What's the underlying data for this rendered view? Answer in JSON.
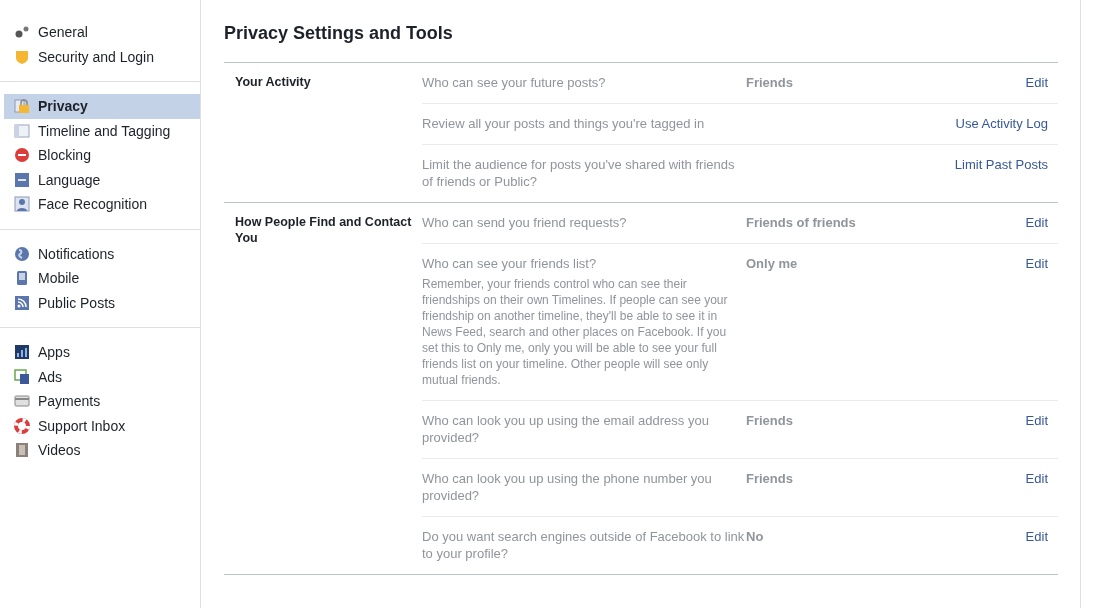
{
  "sidebar": {
    "groups": [
      {
        "items": [
          {
            "label": "General",
            "selected": false
          },
          {
            "label": "Security and Login",
            "selected": false
          }
        ]
      },
      {
        "items": [
          {
            "label": "Privacy",
            "selected": true
          },
          {
            "label": "Timeline and Tagging",
            "selected": false
          },
          {
            "label": "Blocking",
            "selected": false
          },
          {
            "label": "Language",
            "selected": false
          },
          {
            "label": "Face Recognition",
            "selected": false
          }
        ]
      },
      {
        "items": [
          {
            "label": "Notifications",
            "selected": false
          },
          {
            "label": "Mobile",
            "selected": false
          },
          {
            "label": "Public Posts",
            "selected": false
          }
        ]
      },
      {
        "items": [
          {
            "label": "Apps",
            "selected": false
          },
          {
            "label": "Ads",
            "selected": false
          },
          {
            "label": "Payments",
            "selected": false
          },
          {
            "label": "Support Inbox",
            "selected": false
          },
          {
            "label": "Videos",
            "selected": false
          }
        ]
      }
    ]
  },
  "page_title": "Privacy Settings and Tools",
  "sections": [
    {
      "title": "Your Activity",
      "rows": [
        {
          "question": "Who can see your future posts?",
          "value": "Friends",
          "action": "Edit"
        },
        {
          "question": "Review all your posts and things you're tagged in",
          "action": "Use Activity Log"
        },
        {
          "question": "Limit the audience for posts you've shared with friends of friends or Public?",
          "action": "Limit Past Posts"
        }
      ]
    },
    {
      "title": "How People Find and Contact You",
      "rows": [
        {
          "question": "Who can send you friend requests?",
          "value": "Friends of friends",
          "action": "Edit"
        },
        {
          "question": "Who can see your friends list?",
          "description": "Remember, your friends control who can see their friendships on their own Timelines. If people can see your friendship on another timeline, they'll be able to see it in News Feed, search and other places on Facebook. If you set this to Only me, only you will be able to see your full friends list on your timeline. Other people will see only mutual friends.",
          "value": "Only me",
          "action": "Edit"
        },
        {
          "question": "Who can look you up using the email address you provided?",
          "value": "Friends",
          "action": "Edit"
        },
        {
          "question": "Who can look you up using the phone number you provided?",
          "value": "Friends",
          "action": "Edit"
        },
        {
          "question": "Do you want search engines outside of Facebook to link to your profile?",
          "value": "No",
          "action": "Edit"
        }
      ]
    }
  ]
}
